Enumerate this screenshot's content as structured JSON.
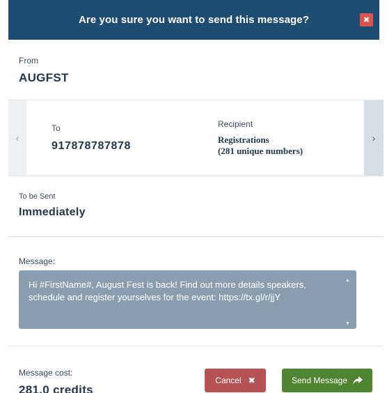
{
  "header": {
    "title": "Are you sure you want to send this message?",
    "close_glyph": "✖"
  },
  "from": {
    "label": "From",
    "value": "AUGFST"
  },
  "carousel": {
    "prev_glyph": "‹",
    "next_glyph": "›",
    "to_label": "To",
    "to_value": "917878787878",
    "recipient_label": "Recipient",
    "recipient_name": "Registrations",
    "recipient_count": "(281 unique numbers)"
  },
  "schedule": {
    "label": "To be Sent",
    "value": "Immediately"
  },
  "message": {
    "label": "Message:",
    "text": "Hi #FirstName#, August Fest is back! Find out more details speakers, schedule and register yourselves for the event: https://tx.gl/r/jjY",
    "scroll_up_glyph": "▲",
    "scroll_down_glyph": "▼"
  },
  "footer": {
    "cost_label": "Message cost:",
    "cost_value": "281.0 credits",
    "cancel_label": "Cancel",
    "cancel_glyph": "✖",
    "send_label": "Send Message"
  },
  "colors": {
    "header_bg": "#1f4c73",
    "close_bg": "#d9534f",
    "message_bg": "#8a9eb1",
    "cancel_bg": "#b65254",
    "send_bg": "#4f8430"
  },
  "icons": {
    "close": "close-icon",
    "prev": "chevron-left-icon",
    "next": "chevron-right-icon",
    "cancel": "close-icon",
    "send": "share-arrow-icon"
  }
}
